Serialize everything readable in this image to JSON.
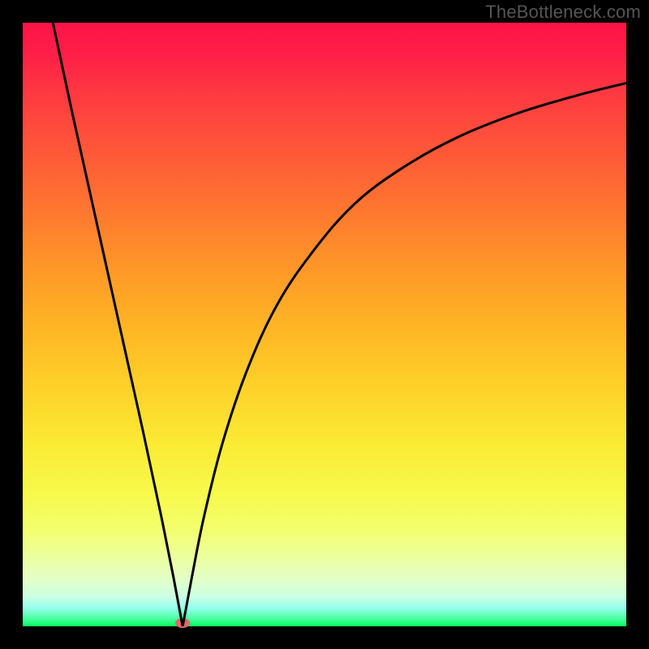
{
  "watermark": "TheBottleneck.com",
  "chart_data": {
    "type": "line",
    "title": "",
    "xlabel": "",
    "ylabel": "",
    "xlim": [
      0,
      100
    ],
    "ylim": [
      0,
      100
    ],
    "grid": false,
    "legend": false,
    "series": [
      {
        "name": "left-branch",
        "x": [
          5,
          8,
          12,
          16,
          20,
          23,
          25,
          26.5
        ],
        "y": [
          100,
          86,
          68,
          50,
          32,
          18,
          8,
          0
        ]
      },
      {
        "name": "right-branch",
        "x": [
          26.5,
          28,
          30,
          33,
          37,
          42,
          48,
          55,
          63,
          72,
          82,
          92,
          100
        ],
        "y": [
          0,
          8,
          18,
          30,
          42,
          53,
          62,
          70,
          76,
          81,
          85,
          88,
          90
        ]
      }
    ],
    "minimum_marker": {
      "x": 26.5,
      "y": 0,
      "color": "#d96a6a"
    },
    "background_gradient": {
      "top": "#fe1349",
      "bottom": "#00ff5a"
    }
  }
}
